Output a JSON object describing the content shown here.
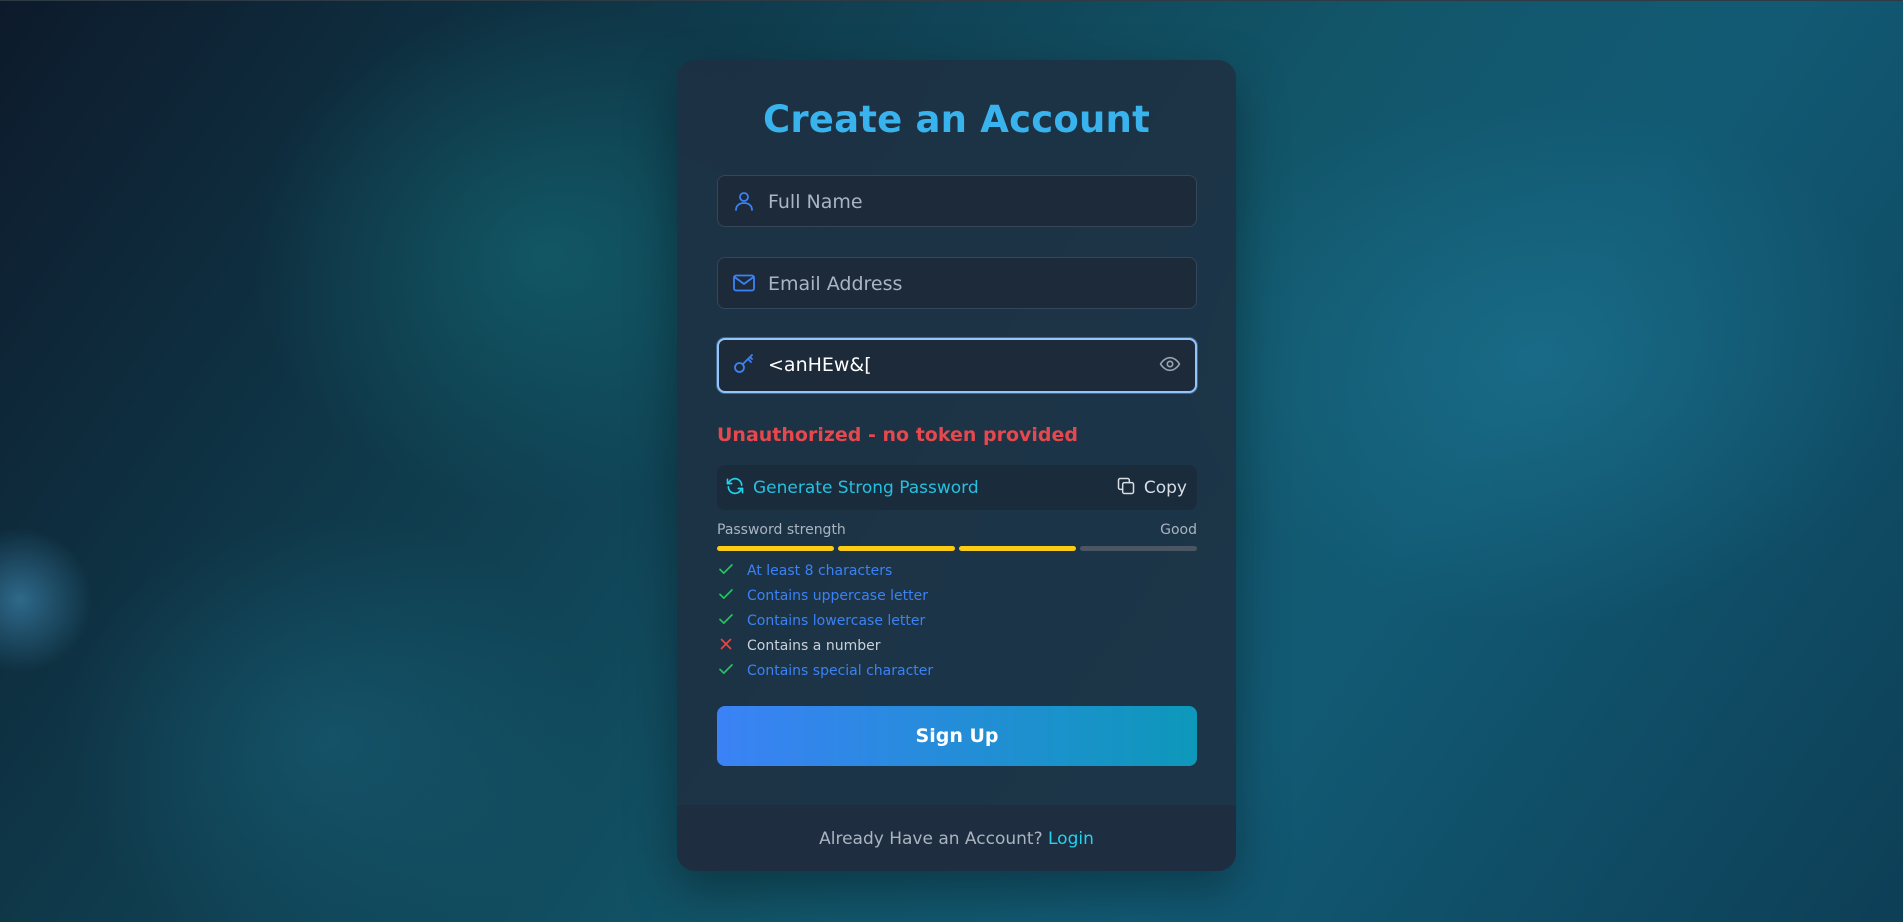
{
  "form": {
    "title": "Create an Account",
    "full_name": {
      "placeholder": "Full Name",
      "value": ""
    },
    "email": {
      "placeholder": "Email Address",
      "value": ""
    },
    "password": {
      "value": "<anHEw&["
    },
    "error_message": "Unauthorized - no token provided",
    "generator": {
      "generate_label": "Generate Strong Password",
      "copy_label": "Copy"
    },
    "strength": {
      "label": "Password strength",
      "rating": "Good",
      "filled_segments": 3,
      "total_segments": 4
    },
    "requirements": [
      {
        "label": "At least 8 characters",
        "met": true
      },
      {
        "label": "Contains uppercase letter",
        "met": true
      },
      {
        "label": "Contains lowercase letter",
        "met": true
      },
      {
        "label": "Contains a number",
        "met": false
      },
      {
        "label": "Contains special character",
        "met": true
      }
    ],
    "submit_label": "Sign Up"
  },
  "footer": {
    "prompt": "Already Have an Account?",
    "login_label": "Login"
  },
  "colors": {
    "title": "#38b3ee",
    "accent_cyan": "#22d3ee",
    "error": "#e5484d",
    "met": "#22c55e",
    "met_text": "#3b82f6",
    "unmet": "#ef4444",
    "strength_filled": "#facc15",
    "strength_empty": "#4b5563"
  }
}
